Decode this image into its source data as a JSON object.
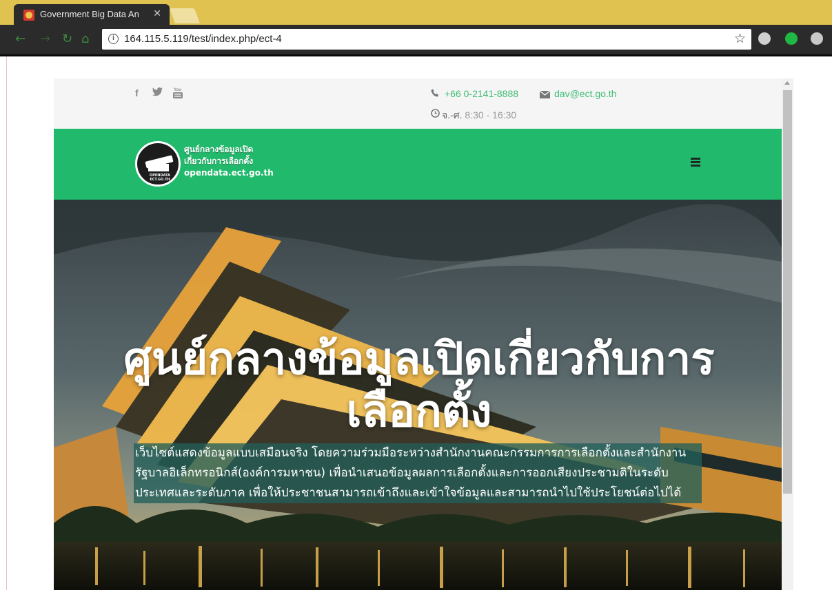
{
  "browser": {
    "tab_title": "Government Big Data An",
    "url": "164.115.5.119/test/index.php/ect-4",
    "colors": {
      "tabstrip": "#dfc24f",
      "toolbar": "#2b2b2b"
    }
  },
  "topbar": {
    "phone": "+66 0-2141-8888",
    "email": "dav@ect.go.th",
    "hours_label": "จ.-ศ.",
    "hours": "8:30 - 16:30",
    "social_icons": [
      "facebook-icon",
      "twitter-icon",
      "youtube-icon"
    ]
  },
  "navbar": {
    "brand_line1": "ศูนย์กลางข้อมูลเปิด",
    "brand_line2": "เกี่ยวกับการเลือกตั้ง",
    "brand_line3": "opendata.ect.go.th",
    "logo_text_1": "OPENDATA",
    "logo_text_2": "ECT.GO.TH",
    "color": "#21b96c"
  },
  "hero": {
    "title": "ศูนย์กลางข้อมูลเปิดเกี่ยวกับการเลือกตั้ง",
    "description": "เว็บไซต์แสดงข้อมูลแบบเสมือนจริง โดยความร่วมมือระหว่างสำนักงานคณะกรรมการการเลือกตั้งและสำนักงานรัฐบาลอิเล็กทรอนิกส์(องค์การมหาชน) เพื่อนำเสนอข้อมูลผลการเลือกตั้งและการออกเสียงประชามติในระดับประเทศและระดับภาค เพื่อให้ประชาชนสามารถเข้าถึงและเข้าใจข้อมูลและสามารถนำไปใช้ประโยชน์ต่อไปได้"
  }
}
